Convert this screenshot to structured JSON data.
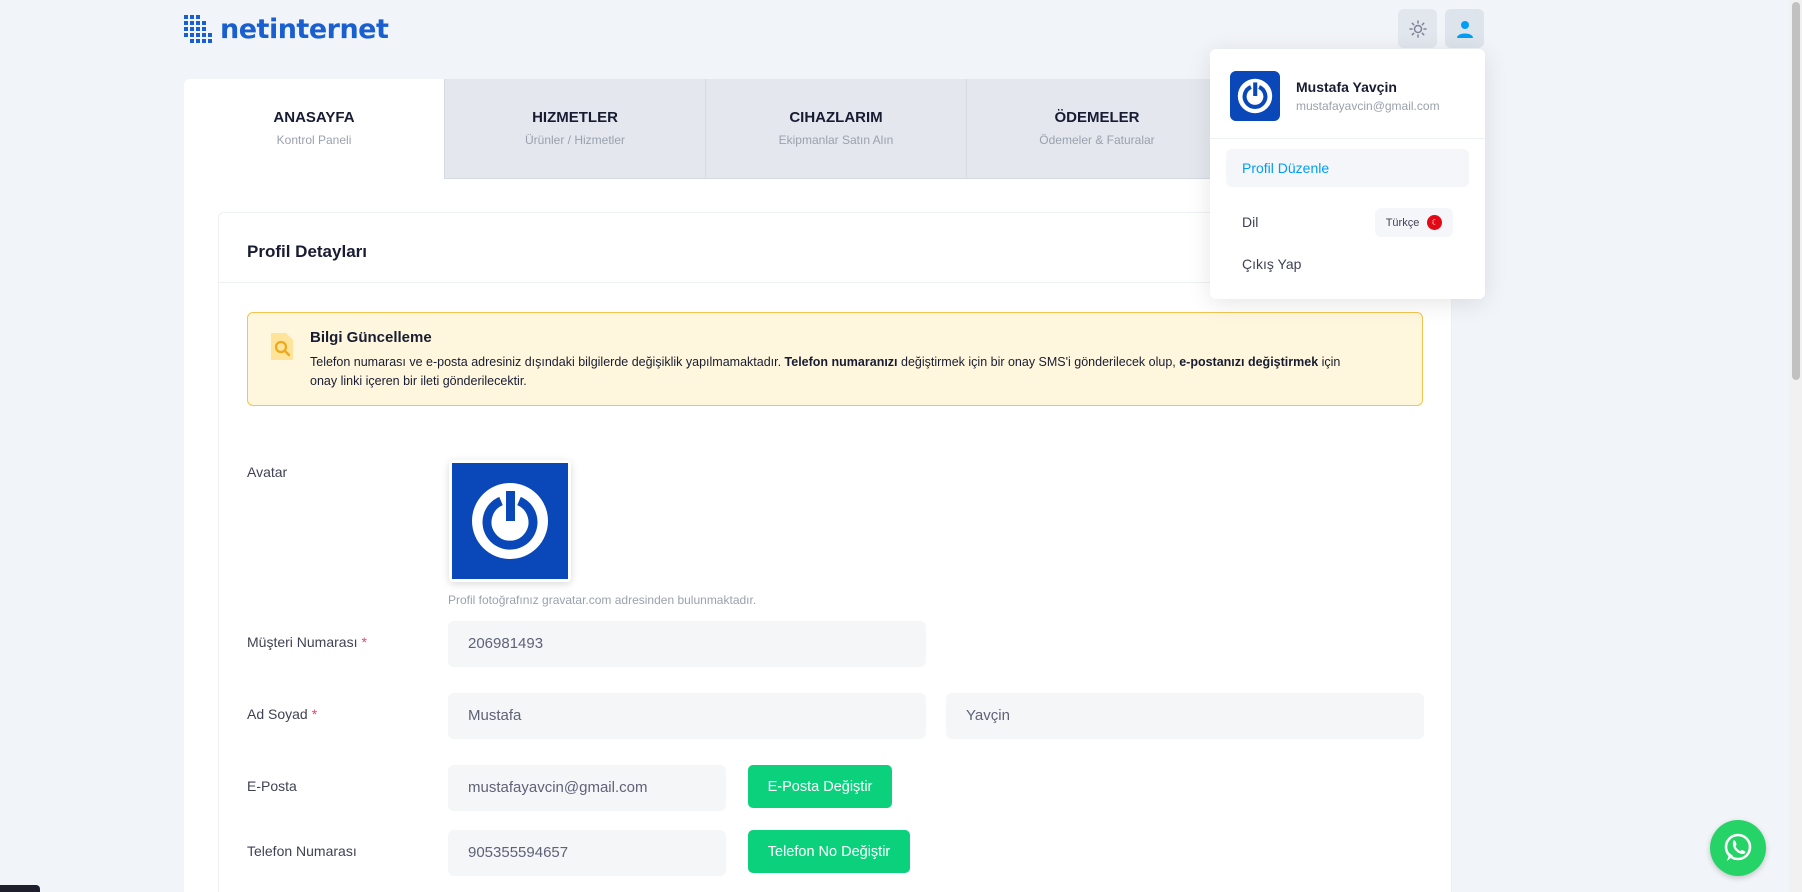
{
  "brand": {
    "name": "netinternet",
    "accent": "#1a5fd0"
  },
  "header": {
    "theme_icon": "sun-icon",
    "user_icon": "user-icon"
  },
  "tabs": [
    {
      "title": "ANASAYFA",
      "sub": "Kontrol Paneli",
      "active": true
    },
    {
      "title": "HIZMETLER",
      "sub": "Ürünler / Hizmetler"
    },
    {
      "title": "CIHAZLARIM",
      "sub": "Ekipmanlar Satın Alın"
    },
    {
      "title": "ÖDEMELER",
      "sub": "Ödemeler & Faturalar"
    }
  ],
  "profile": {
    "title": "Profil Detayları",
    "notice": {
      "title": "Bilgi Güncelleme",
      "text_1": "Telefon numarası ve e-posta adresiniz dışındaki bilgilerde değişiklik yapılmamaktadır. ",
      "bold_1": "Telefon numaranızı",
      "text_2": " değiştirmek için bir onay SMS'i gönderilecek olup, ",
      "bold_2": "e-postanızı değiştirmek",
      "text_3": " için onay linki içeren bir ileti gönderilecektir."
    },
    "avatar_label": "Avatar",
    "avatar_hint": "Profil fotoğrafınız gravatar.com adresinden bulunmaktadır.",
    "customer_no_label": "Müşteri Numarası",
    "customer_no": "206981493",
    "name_label": "Ad Soyad",
    "first_name": "Mustafa",
    "last_name": "Yavçin",
    "email_label": "E-Posta",
    "email": "mustafayavcin@gmail.com",
    "email_button": "E-Posta Değiştir",
    "phone_label": "Telefon Numarası",
    "phone": "905355594657",
    "phone_button": "Telefon No Değiştir",
    "required_mark": "*"
  },
  "dropdown": {
    "name": "Mustafa Yavçin",
    "email": "mustafayavcin@gmail.com",
    "edit_profile": "Profil Düzenle",
    "language_label": "Dil",
    "language_value": "Türkçe",
    "logout": "Çıkış Yap"
  },
  "colors": {
    "green": "#0bd17d",
    "notice_bg": "#fff7dd",
    "notice_border": "#f3c44e",
    "link": "#009ef7"
  }
}
